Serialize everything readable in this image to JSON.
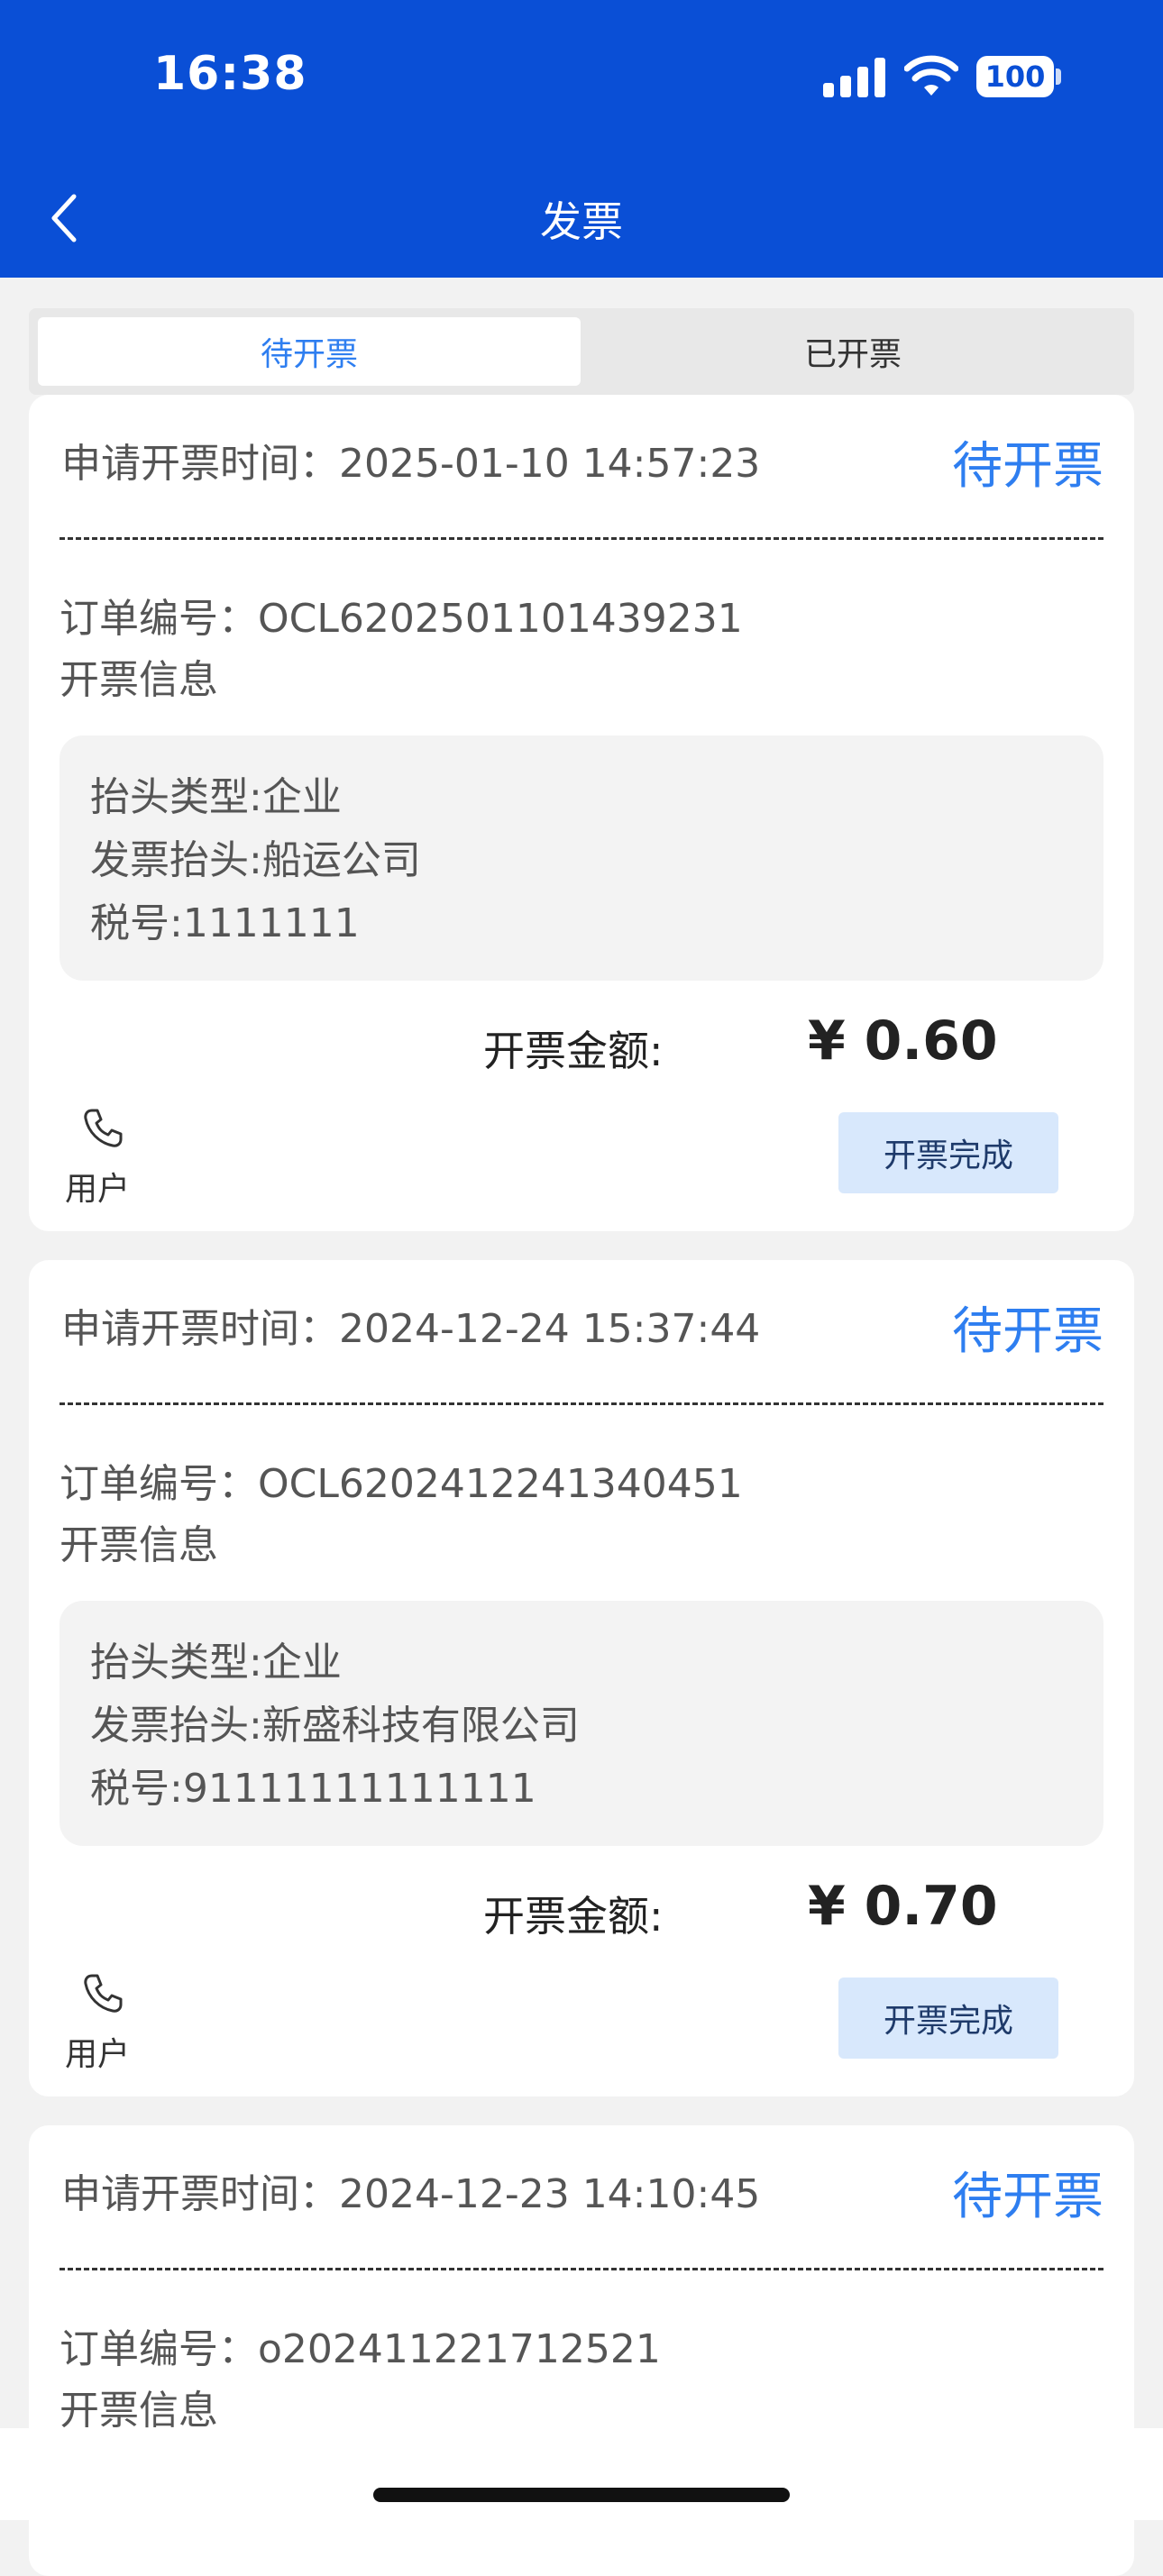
{
  "status_bar": {
    "time": "16:38",
    "battery": "100"
  },
  "nav": {
    "title": "发票"
  },
  "tabs": [
    {
      "label": "待开票"
    },
    {
      "label": "已开票"
    }
  ],
  "colors": {
    "header": "#0a4fd6",
    "accent": "#2e7ef0",
    "button_bg": "#d8e8fc"
  },
  "icons": {
    "back": "chevron-left-icon",
    "phone": "phone-icon",
    "signal": "signal-icon",
    "wifi": "wifi-icon"
  },
  "cards": [
    {
      "time": "申请开票时间：2025-01-10 14:57:23",
      "status": "待开票",
      "order_no": "订单编号：OCL6202501101439231",
      "info_title": "开票信息",
      "title_type": "抬头类型:企业",
      "invoice_title": "发票抬头:船运公司",
      "tax_no": "税号:1111111",
      "amount_label": "开票金额:",
      "amount": "¥ 0.60",
      "user_label": "用户",
      "button": "开票完成"
    },
    {
      "time": "申请开票时间：2024-12-24 15:37:44",
      "status": "待开票",
      "order_no": "订单编号：OCL6202412241340451",
      "info_title": "开票信息",
      "title_type": "抬头类型:企业",
      "invoice_title": "发票抬头:新盛科技有限公司",
      "tax_no": "税号:91111111111111",
      "amount_label": "开票金额:",
      "amount": "¥ 0.70",
      "user_label": "用户",
      "button": "开票完成"
    },
    {
      "time": "申请开票时间：2024-12-23 14:10:45",
      "status": "待开票",
      "order_no": "订单编号：o202411221712521",
      "info_title": "开票信息"
    }
  ]
}
